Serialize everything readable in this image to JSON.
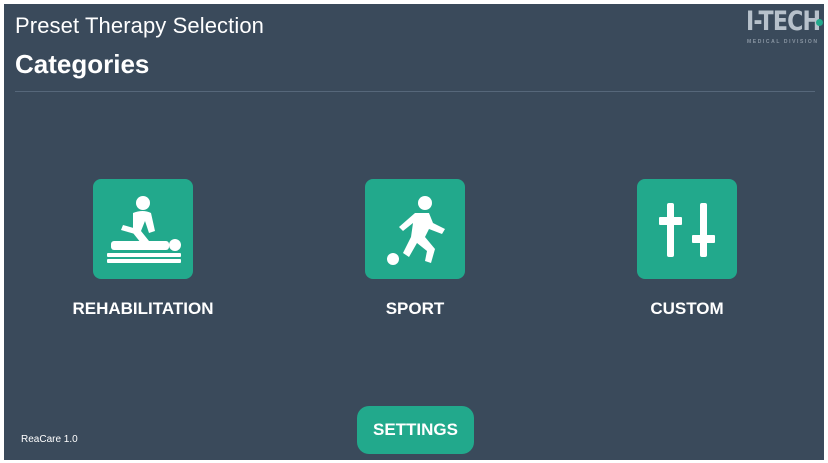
{
  "header": {
    "title": "Preset Therapy Selection",
    "subtitle": "Categories"
  },
  "logo": {
    "text": "I-TECH",
    "subtext": "MEDICAL DIVISION"
  },
  "categories": [
    {
      "label": "REHABILITATION",
      "icon": "rehabilitation-massage-icon"
    },
    {
      "label": "SPORT",
      "icon": "soccer-player-icon"
    },
    {
      "label": "CUSTOM",
      "icon": "sliders-icon"
    }
  ],
  "footer": {
    "settings_label": "SETTINGS",
    "version": "ReaCare 1.0"
  },
  "colors": {
    "background": "#3a4a5b",
    "accent": "#22a98c",
    "text": "#ffffff"
  }
}
